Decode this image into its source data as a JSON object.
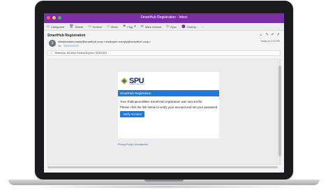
{
  "window": {
    "title": "SmartHub Registration - Inbox"
  },
  "toolbar": {
    "items": [
      {
        "label": "Categorize",
        "icon": "tag-icon"
      },
      {
        "label": "Delete",
        "icon": "trash-icon"
      },
      {
        "label": "Archive",
        "icon": "archive-icon"
      },
      {
        "label": "Move",
        "icon": "folder-icon"
      },
      {
        "label": "Flag",
        "icon": "flag-icon"
      },
      {
        "label": "Mark Unread",
        "icon": "envelope-icon"
      },
      {
        "label": "Sync",
        "icon": "sync-icon"
      },
      {
        "label": "ClickUp",
        "icon": "clickup-icon"
      },
      {
        "label": "···",
        "icon": "more-icon"
      }
    ]
  },
  "message": {
    "subject": "SmartHub Registration",
    "avatar_initial": "S",
    "from": "sfdsfpesdsknoreply@smarthub.coop <shakopee-noreply@smarthub.coop>",
    "to_label": "To:",
    "date": "Today at 2:23 PM",
    "retention": "Retention: All other Folders Expires: 9/28/2033"
  },
  "email": {
    "logo_text": "SPU",
    "logo_subtitle": "Shakopee Public Utilities",
    "banner": "SmartHub Registration",
    "line1": "Your shakopeeutilities SmartHub registration was successful.",
    "line2": "Please click the link below to verify your account and set your password.",
    "button": "Verify Account",
    "footer_links": "Privacy Policy | Unsubscribe"
  },
  "colors": {
    "titlebar": "#7a2fa7",
    "accent_blue": "#1d7ad8",
    "logo_navy": "#0b2e6b"
  }
}
